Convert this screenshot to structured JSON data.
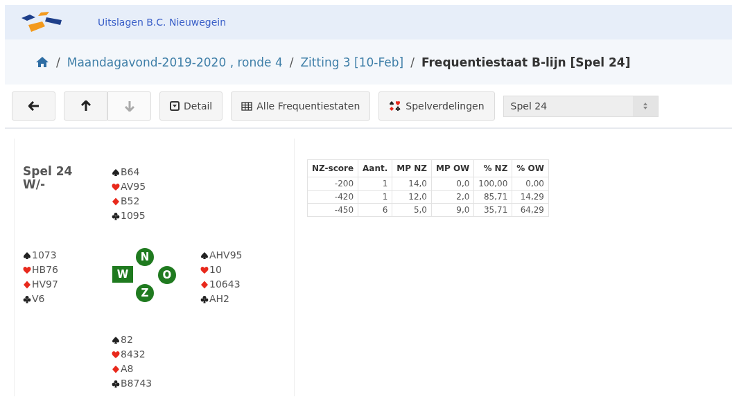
{
  "header": {
    "title": "Uitslagen B.C. Nieuwegein"
  },
  "breadcrumb": {
    "items": [
      {
        "kind": "separator",
        "text": "/"
      },
      {
        "kind": "link",
        "text": "Maandagavond-2019-2020 , ronde 4"
      },
      {
        "kind": "separator",
        "text": "/"
      },
      {
        "kind": "link",
        "text": "Zitting 3 [10-Feb]"
      },
      {
        "kind": "separator",
        "text": "/"
      },
      {
        "kind": "current",
        "text": "Frequentiestaat B-lijn [Spel 24]"
      }
    ]
  },
  "toolbar": {
    "nav": [
      {
        "kind": "back",
        "disabled": false
      },
      {
        "kind": "up",
        "disabled": false
      },
      {
        "kind": "down",
        "disabled": true
      }
    ],
    "buttons": [
      {
        "kind": "detail",
        "label": "Detail"
      },
      {
        "kind": "grid",
        "label": "Alle Frequentiestaten"
      },
      {
        "kind": "suits",
        "label": "Spelverdelingen"
      }
    ],
    "select": {
      "value": "Spel 24"
    }
  },
  "deal": {
    "title": "Spel 24",
    "vulnerability": "W/-",
    "hands": {
      "north": [
        "B64",
        "AV95",
        "B52",
        "1095"
      ],
      "west": [
        "1073",
        "HB76",
        "HV97",
        "V6"
      ],
      "east": [
        "AHV95",
        "10",
        "10643",
        "AH2"
      ],
      "south": [
        "82",
        "8432",
        "A8",
        "B8743"
      ]
    },
    "seats": [
      {
        "label": "N",
        "dealer": false
      },
      {
        "label": "W",
        "dealer": true
      },
      {
        "label": "O",
        "dealer": false
      },
      {
        "label": "Z",
        "dealer": false
      }
    ]
  },
  "table": {
    "columns": [
      "NZ-score",
      "Aant.",
      "MP NZ",
      "MP OW",
      "% NZ",
      "% OW"
    ],
    "rows": [
      [
        "-200",
        "1",
        "14,0",
        "0,0",
        "100,00",
        "0,00"
      ],
      [
        "-420",
        "1",
        "12,0",
        "2,0",
        "85,71",
        "14,29"
      ],
      [
        "-450",
        "6",
        "5,0",
        "9,0",
        "35,71",
        "64,29"
      ]
    ]
  }
}
